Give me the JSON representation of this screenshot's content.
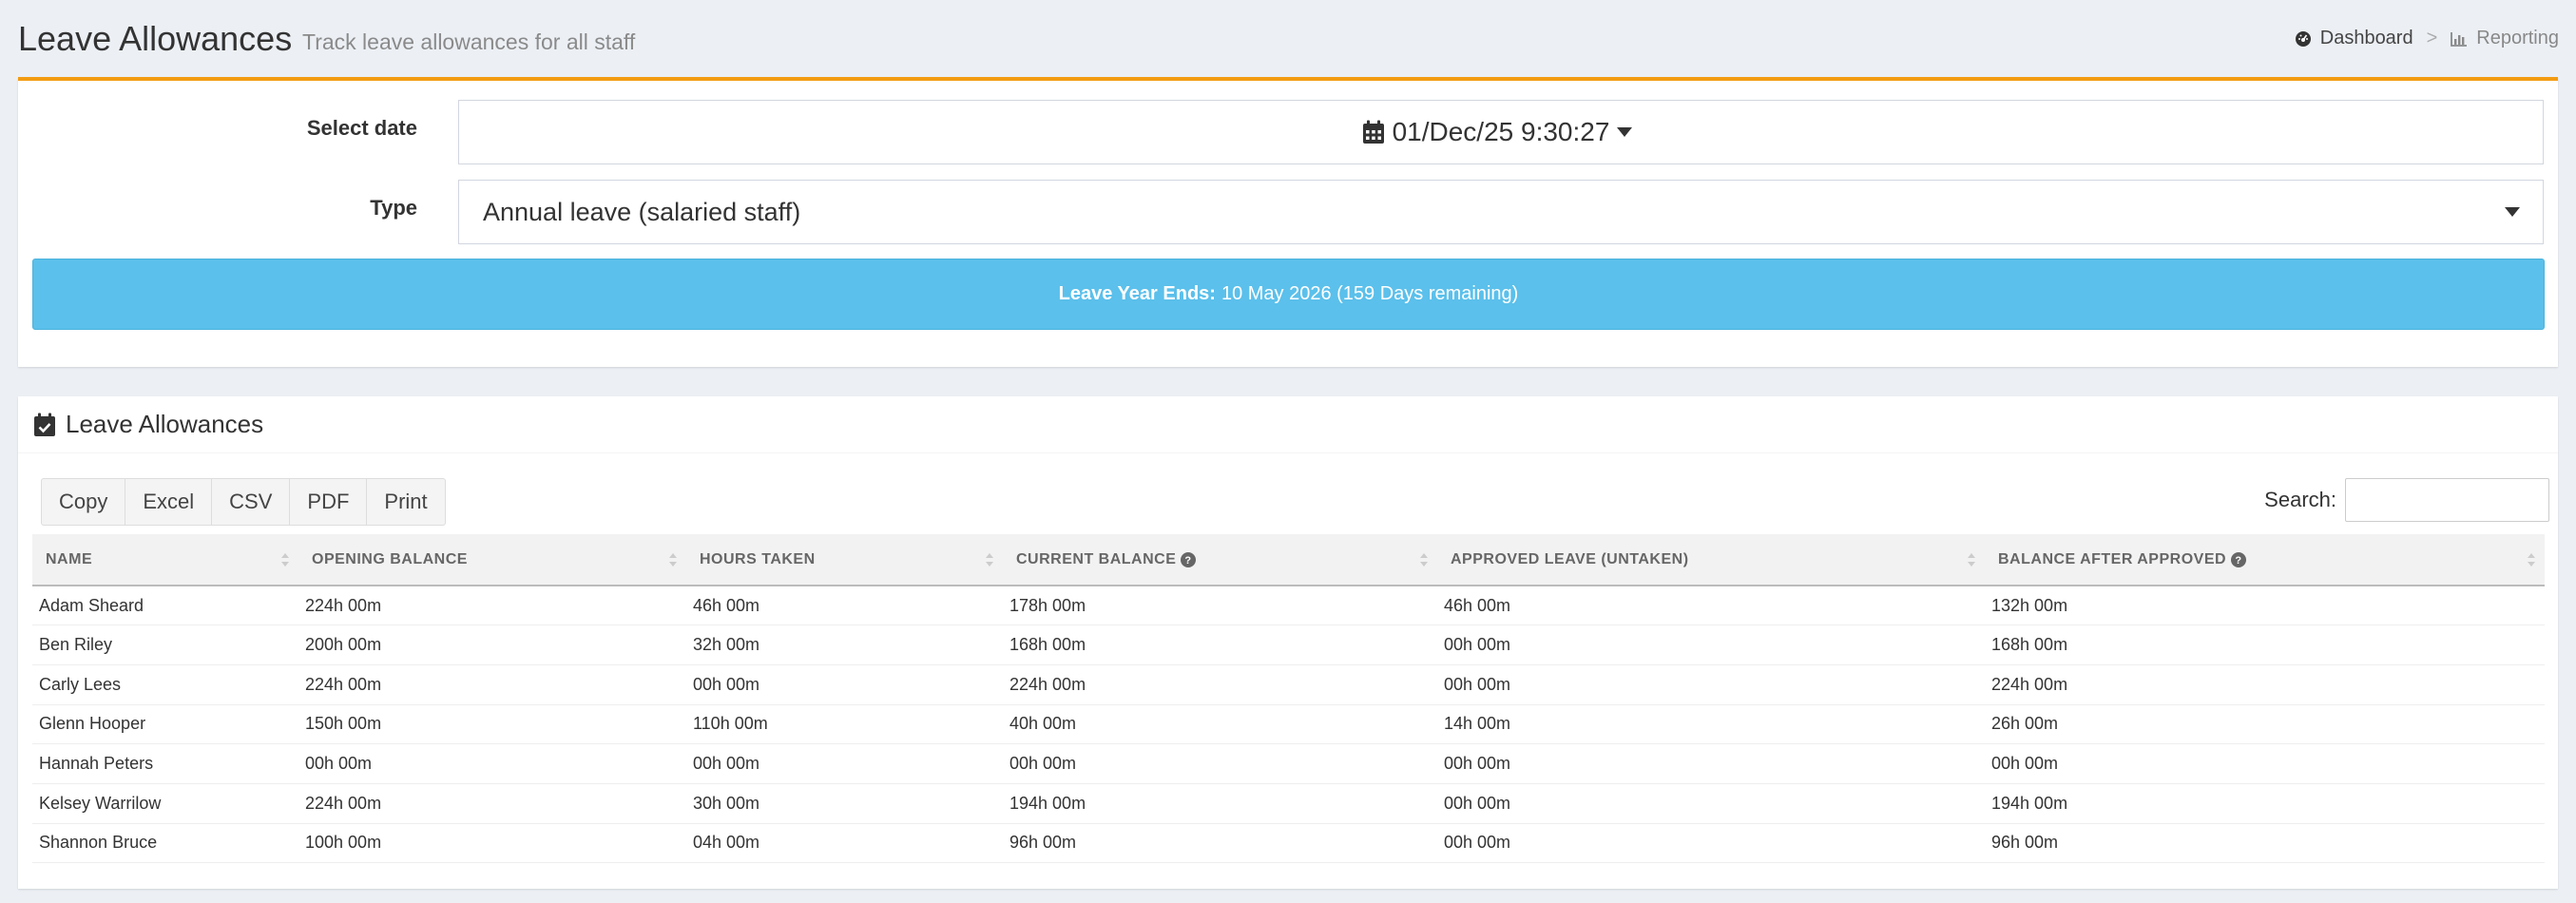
{
  "header": {
    "title": "Leave Allowances",
    "subtitle": "Track leave allowances for all staff",
    "breadcrumb": [
      {
        "label": "Dashboard",
        "icon": "dashboard-icon"
      },
      {
        "label": "Reporting",
        "icon": "bar-chart-icon"
      }
    ]
  },
  "filters": {
    "date_label": "Select date",
    "date_value": "01/Dec/25 9:30:27",
    "type_label": "Type",
    "type_value": "Annual leave (salaried staff)"
  },
  "info": {
    "label": "Leave Year Ends:",
    "text": "10 May 2026 (159 Days remaining)",
    "color": "#5bc0eb"
  },
  "table_box": {
    "title": "Leave Allowances",
    "buttons": [
      "Copy",
      "Excel",
      "CSV",
      "PDF",
      "Print"
    ],
    "search_label": "Search:",
    "search_value": "",
    "columns": [
      "Name",
      "Opening Balance",
      "Hours Taken",
      "Current Balance",
      "Approved Leave (Untaken)",
      "Balance After Approved"
    ],
    "rows": [
      [
        "Adam Sheard",
        "224h 00m",
        "46h 00m",
        "178h 00m",
        "46h 00m",
        "132h 00m"
      ],
      [
        "Ben Riley",
        "200h 00m",
        "32h 00m",
        "168h 00m",
        "00h 00m",
        "168h 00m"
      ],
      [
        "Carly Lees",
        "224h 00m",
        "00h 00m",
        "224h 00m",
        "00h 00m",
        "224h 00m"
      ],
      [
        "Glenn Hooper",
        "150h 00m",
        "110h 00m",
        "40h 00m",
        "14h 00m",
        "26h 00m"
      ],
      [
        "Hannah Peters",
        "00h 00m",
        "00h 00m",
        "00h 00m",
        "00h 00m",
        "00h 00m"
      ],
      [
        "Kelsey Warrilow",
        "224h 00m",
        "30h 00m",
        "194h 00m",
        "00h 00m",
        "194h 00m"
      ],
      [
        "Shannon Bruce",
        "100h 00m",
        "04h 00m",
        "96h 00m",
        "00h 00m",
        "96h 00m"
      ]
    ]
  },
  "colors": {
    "accent": "#f39c12",
    "background": "#ecf0f5"
  }
}
